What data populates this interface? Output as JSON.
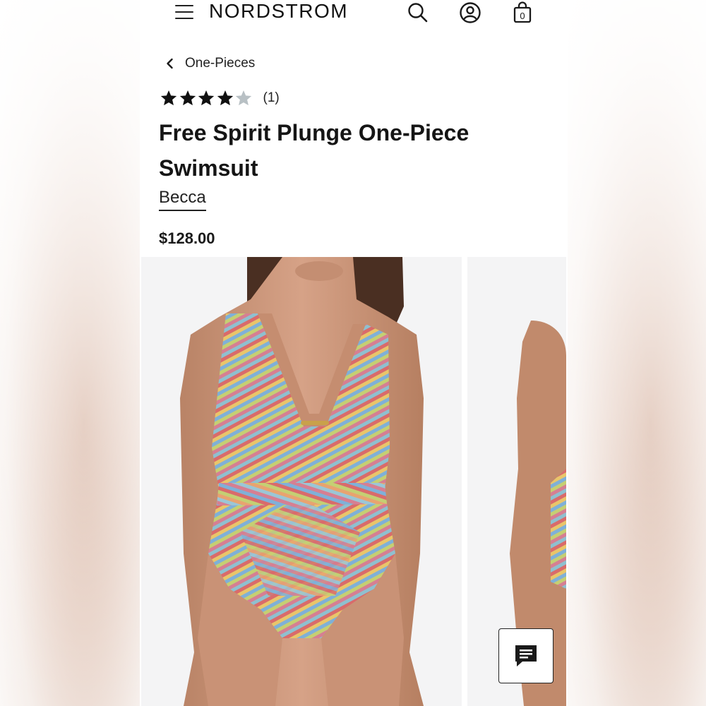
{
  "header": {
    "logo": "NORDSTROM",
    "bag_count": "0"
  },
  "breadcrumb": {
    "label": "One-Pieces"
  },
  "product": {
    "rating": 4,
    "rating_max": 5,
    "review_count": "(1)",
    "title": "Free Spirit Plunge One-Piece Swimsuit",
    "brand": "Becca",
    "price": "$128.00"
  },
  "colors": {
    "star_filled": "#111111",
    "star_empty": "#b8c0c4",
    "image_bg": "#f4f4f5"
  },
  "icons": {
    "menu": "menu-icon",
    "search": "search-icon",
    "account": "account-icon",
    "bag": "shopping-bag-icon",
    "back": "chevron-left-icon",
    "chat": "chat-icon"
  }
}
